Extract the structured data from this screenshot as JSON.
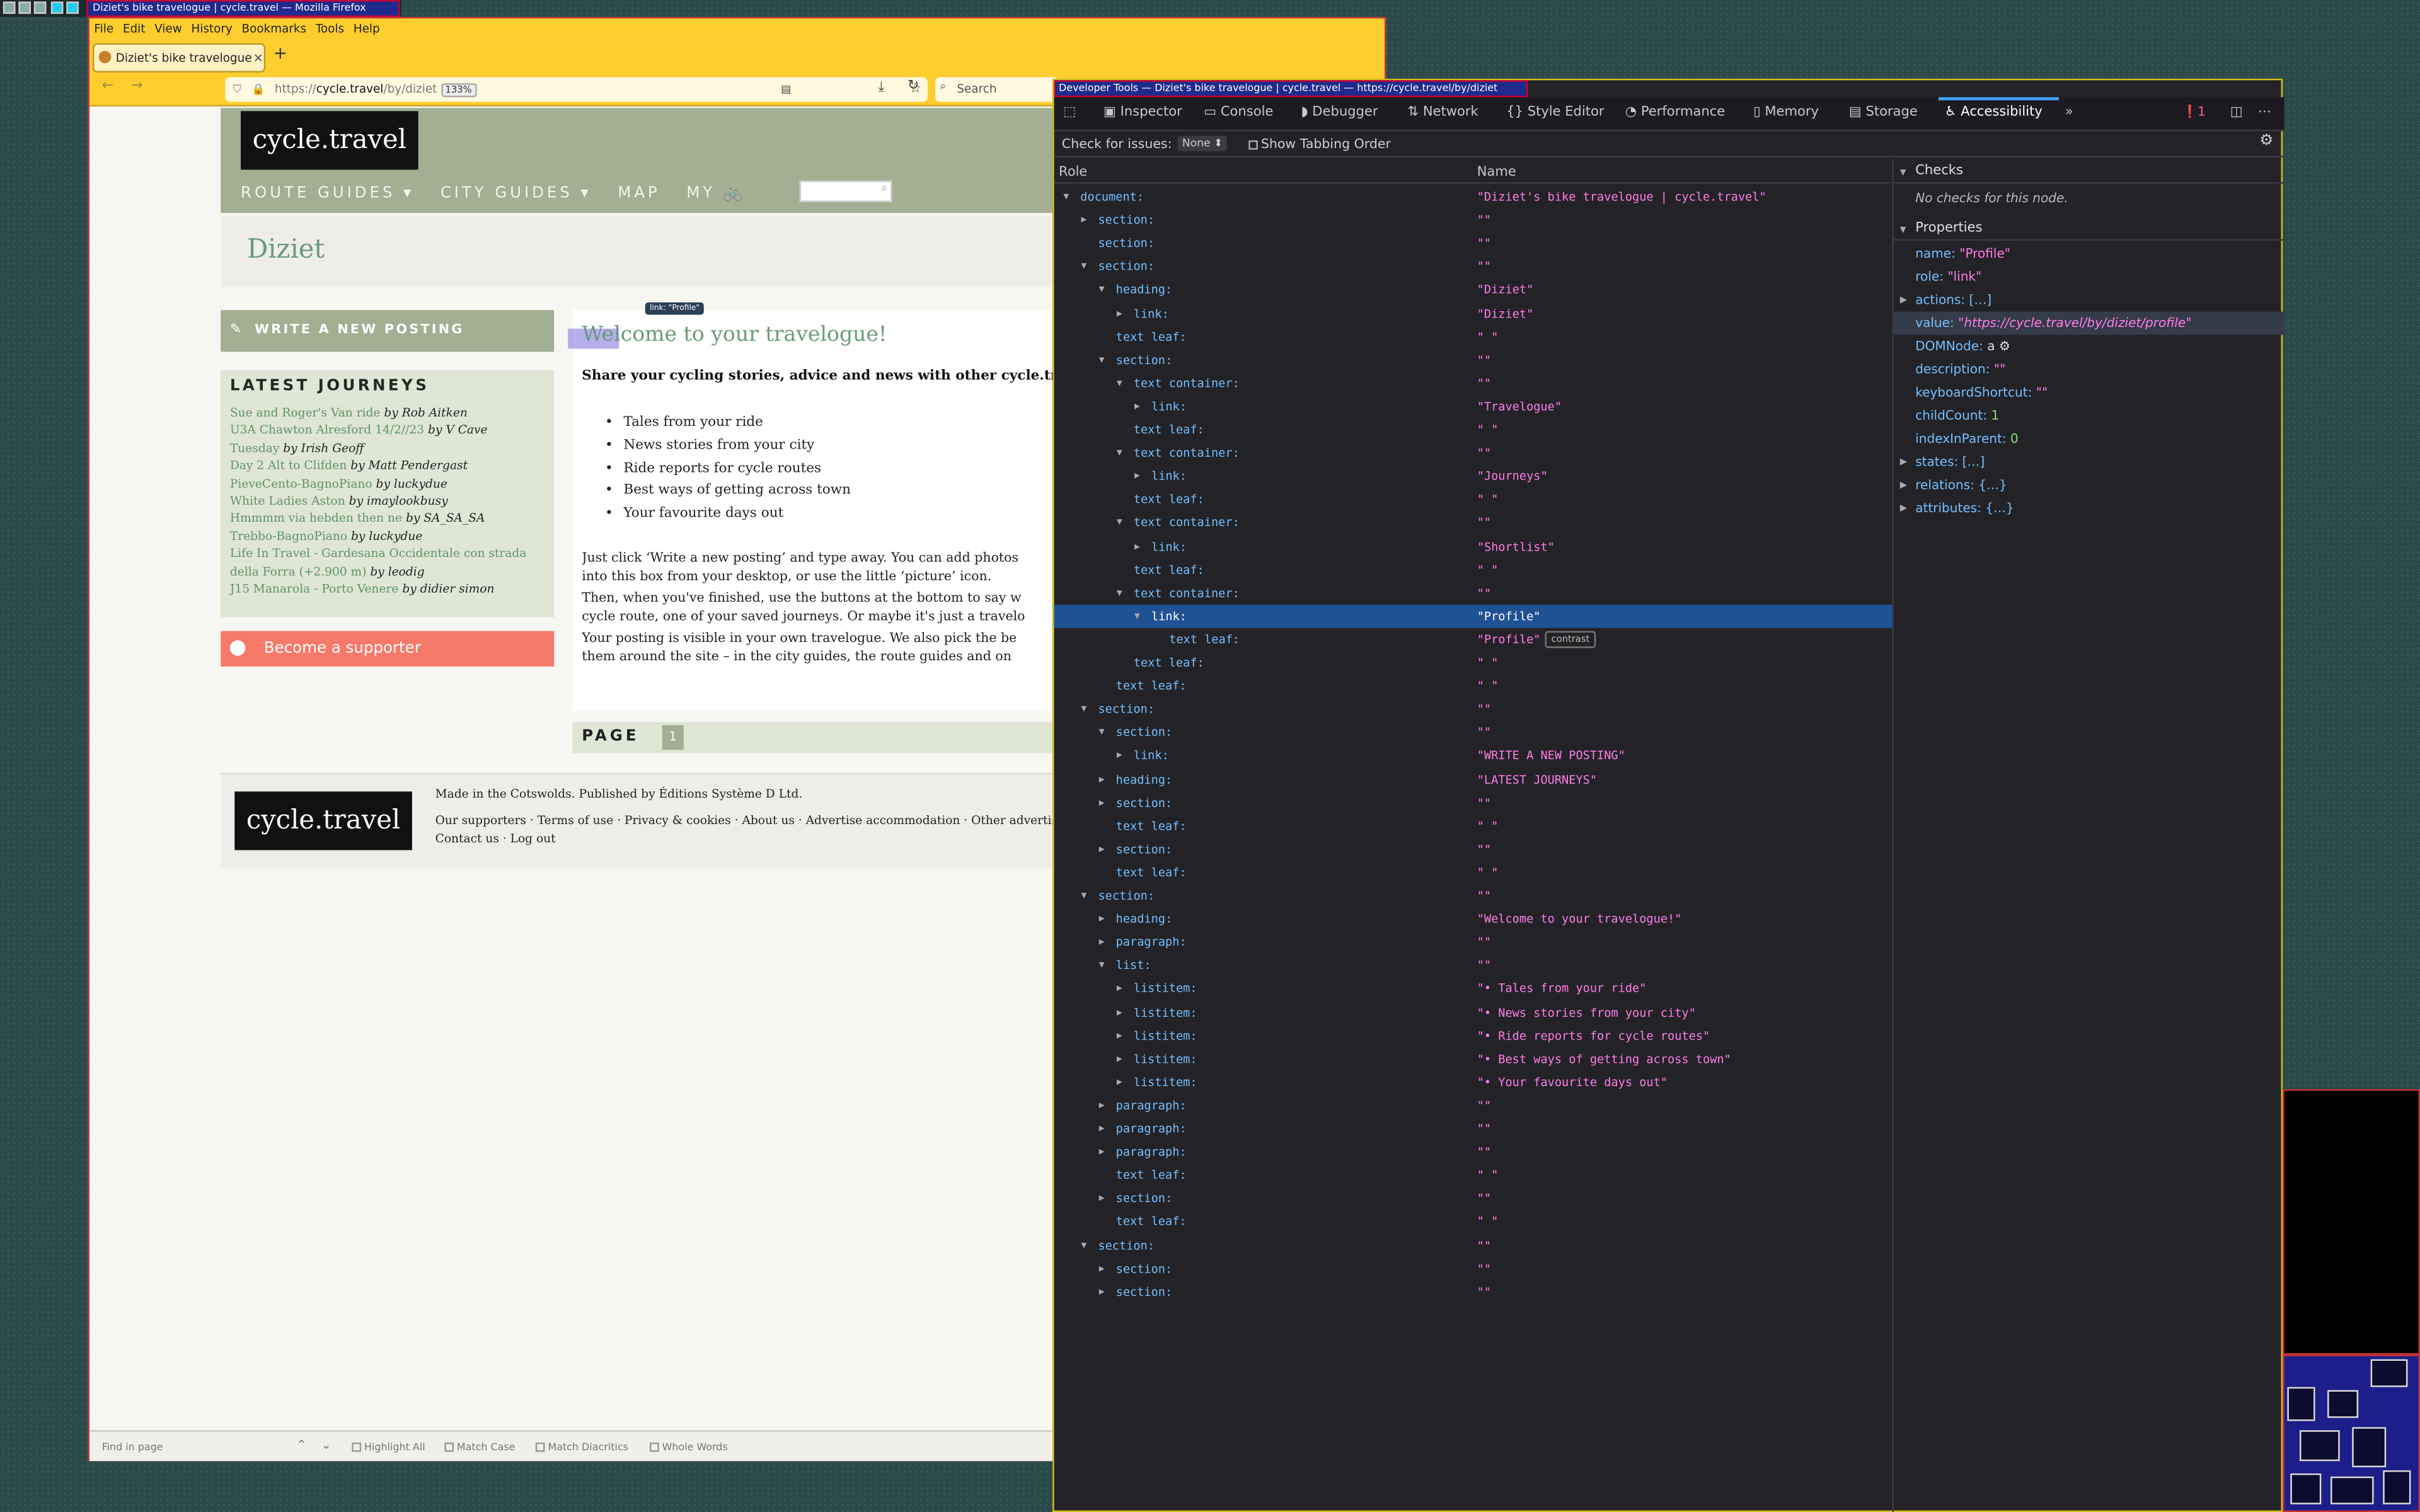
{
  "firefox": {
    "window_title": "Diziet's bike travelogue | cycle.travel — Mozilla Firefox",
    "menu": [
      "File",
      "Edit",
      "View",
      "History",
      "Bookmarks",
      "Tools",
      "Help"
    ],
    "tab_title": "Diziet's bike travelogue",
    "tab_close": "×",
    "new_tab": "+",
    "url_prefix": "https://",
    "url_domain": "cycle.travel",
    "url_path": "/by/diziet",
    "zoom": "133%",
    "search_placeholder": "Search",
    "find": {
      "placeholder": "Find in page",
      "highlight_all": "Highlight All",
      "match_case": "Match Case",
      "match_diacritics": "Match Diacritics",
      "whole_words": "Whole Words"
    }
  },
  "site": {
    "logo": "cycle.travel",
    "nav": [
      "ROUTE GUIDES ▾",
      "CITY GUIDES ▾",
      "MAP",
      "MY 🚲"
    ],
    "page_title": "Diziet",
    "write_button": "WRITE A NEW POSTING",
    "journeys_title": "LATEST JOURNEYS",
    "journeys": [
      {
        "title": "Sue and Roger's Van ride",
        "by": "by Rob Aitken"
      },
      {
        "title": "U3A Chawton Alresford 14/2//23",
        "by": "by V Cave"
      },
      {
        "title": "Tuesday",
        "by": "by Irish Geoff"
      },
      {
        "title": "Day 2 Alt to Clifden",
        "by": "by Matt Pendergast"
      },
      {
        "title": "PieveCento-BagnoPiano",
        "by": "by luckydue"
      },
      {
        "title": "White Ladies Aston",
        "by": "by imaylookbusy"
      },
      {
        "title": "Hmmmm via hebden then ne",
        "by": "by SA_SA_SA"
      },
      {
        "title": "Trebbo-BagnoPiano",
        "by": "by luckydue"
      },
      {
        "title": "Life In Travel - Gardesana Occidentale con strada",
        "by": ""
      },
      {
        "title": "della Forra (+2.900 m)",
        "by": "by leodig"
      },
      {
        "title": "J15 Manarola - Porto Venere",
        "by": "by didier simon"
      }
    ],
    "supporter": "Become a supporter",
    "welcome": "Welcome to your travelogue!",
    "tooltip": "link: \"Profile\"",
    "intro": "Share your cycling stories, advice and news with other cycle.tr",
    "bullets": [
      "Tales from your ride",
      "News stories from your city",
      "Ride reports for cycle routes",
      "Best ways of getting across town",
      "Your favourite days out"
    ],
    "para1a": "Just click ‘Write a new posting’ and type away. You can add photos",
    "para1b": "into this box from your desktop, or use the little ‘picture’ icon.",
    "para2a": "Then, when you've finished, use the buttons at the bottom to say w",
    "para2b": "cycle route, one of your saved journeys. Or maybe it's just a travelo",
    "para3a": "Your posting is visible in your own travelogue. We also pick the be",
    "para3b": "them around the site – in the city guides, the route guides and on",
    "pager_label": "PAGE",
    "pager_num": "1",
    "footer_logo": "cycle.travel",
    "footer_made": "Made in the Cotswolds. Published by Éditions Système D Ltd.",
    "footer_links1": "Our supporters · Terms of use · Privacy & cookies · About us · Advertise accommodation · Other advertising",
    "footer_links2": "Contact us · Log out"
  },
  "devtools": {
    "title": "Developer Tools — Diziet's bike travelogue | cycle.travel — https://cycle.travel/by/diziet",
    "tabs": [
      "Inspector",
      "Console",
      "Debugger",
      "Network",
      "Style Editor",
      "Performance",
      "Memory",
      "Storage",
      "Accessibility"
    ],
    "active_tab": "Accessibility",
    "error_count": "1",
    "check_label": "Check for issues:",
    "check_value": "None ⬍",
    "tabbing_label": "Show Tabbing Order",
    "col_role": "Role",
    "col_name": "Name",
    "tree": [
      {
        "d": 0,
        "t": "open",
        "role": "document:",
        "name": "\"Diziet's bike travelogue | cycle.travel\""
      },
      {
        "d": 1,
        "t": "closed",
        "role": "section:",
        "name": "\"\""
      },
      {
        "d": 1,
        "t": "none",
        "role": "section:",
        "name": "\"\""
      },
      {
        "d": 1,
        "t": "open",
        "role": "section:",
        "name": "\"\""
      },
      {
        "d": 2,
        "t": "open",
        "role": "heading:",
        "name": "\"Diziet\""
      },
      {
        "d": 3,
        "t": "closed",
        "role": "link:",
        "name": "\"Diziet\""
      },
      {
        "d": 2,
        "t": "none",
        "role": "text leaf:",
        "name": "\" \""
      },
      {
        "d": 2,
        "t": "open",
        "role": "section:",
        "name": "\"\""
      },
      {
        "d": 3,
        "t": "open",
        "role": "text container:",
        "name": "\"\""
      },
      {
        "d": 4,
        "t": "closed",
        "role": "link:",
        "name": "\"Travelogue\""
      },
      {
        "d": 3,
        "t": "none",
        "role": "text leaf:",
        "name": "\" \""
      },
      {
        "d": 3,
        "t": "open",
        "role": "text container:",
        "name": "\"\""
      },
      {
        "d": 4,
        "t": "closed",
        "role": "link:",
        "name": "\"Journeys\""
      },
      {
        "d": 3,
        "t": "none",
        "role": "text leaf:",
        "name": "\" \""
      },
      {
        "d": 3,
        "t": "open",
        "role": "text container:",
        "name": "\"\""
      },
      {
        "d": 4,
        "t": "closed",
        "role": "link:",
        "name": "\"Shortlist\""
      },
      {
        "d": 3,
        "t": "none",
        "role": "text leaf:",
        "name": "\" \""
      },
      {
        "d": 3,
        "t": "open",
        "role": "text container:",
        "name": "\"\""
      },
      {
        "d": 4,
        "t": "open",
        "role": "link:",
        "name": "\"Profile\"",
        "sel": true
      },
      {
        "d": 5,
        "t": "none",
        "role": "text leaf:",
        "name": "\"Profile\"",
        "badge": "contrast"
      },
      {
        "d": 3,
        "t": "none",
        "role": "text leaf:",
        "name": "\" \""
      },
      {
        "d": 2,
        "t": "none",
        "role": "text leaf:",
        "name": "\" \""
      },
      {
        "d": 1,
        "t": "open",
        "role": "section:",
        "name": "\"\""
      },
      {
        "d": 2,
        "t": "open",
        "role": "section:",
        "name": "\"\""
      },
      {
        "d": 3,
        "t": "closed",
        "role": "link:",
        "name": "\"WRITE A NEW POSTING\""
      },
      {
        "d": 2,
        "t": "closed",
        "role": "heading:",
        "name": "\"LATEST JOURNEYS\""
      },
      {
        "d": 2,
        "t": "closed",
        "role": "section:",
        "name": "\"\""
      },
      {
        "d": 2,
        "t": "none",
        "role": "text leaf:",
        "name": "\" \""
      },
      {
        "d": 2,
        "t": "closed",
        "role": "section:",
        "name": "\"\""
      },
      {
        "d": 2,
        "t": "none",
        "role": "text leaf:",
        "name": "\" \""
      },
      {
        "d": 1,
        "t": "open",
        "role": "section:",
        "name": "\"\""
      },
      {
        "d": 2,
        "t": "closed",
        "role": "heading:",
        "name": "\"Welcome to your travelogue!\""
      },
      {
        "d": 2,
        "t": "closed",
        "role": "paragraph:",
        "name": "\"\""
      },
      {
        "d": 2,
        "t": "open",
        "role": "list:",
        "name": "\"\""
      },
      {
        "d": 3,
        "t": "closed",
        "role": "listitem:",
        "name": "\"• Tales from your ride\""
      },
      {
        "d": 3,
        "t": "closed",
        "role": "listitem:",
        "name": "\"• News stories from your city\""
      },
      {
        "d": 3,
        "t": "closed",
        "role": "listitem:",
        "name": "\"• Ride reports for cycle routes\""
      },
      {
        "d": 3,
        "t": "closed",
        "role": "listitem:",
        "name": "\"• Best ways of getting across town\""
      },
      {
        "d": 3,
        "t": "closed",
        "role": "listitem:",
        "name": "\"• Your favourite days out\""
      },
      {
        "d": 2,
        "t": "closed",
        "role": "paragraph:",
        "name": "\"\""
      },
      {
        "d": 2,
        "t": "closed",
        "role": "paragraph:",
        "name": "\"\""
      },
      {
        "d": 2,
        "t": "closed",
        "role": "paragraph:",
        "name": "\"\""
      },
      {
        "d": 2,
        "t": "none",
        "role": "text leaf:",
        "name": "\" \""
      },
      {
        "d": 2,
        "t": "closed",
        "role": "section:",
        "name": "\"\""
      },
      {
        "d": 2,
        "t": "none",
        "role": "text leaf:",
        "name": "\" \""
      },
      {
        "d": 1,
        "t": "open",
        "role": "section:",
        "name": "\"\""
      },
      {
        "d": 2,
        "t": "closed",
        "role": "section:",
        "name": "\"\""
      },
      {
        "d": 2,
        "t": "closed",
        "role": "section:",
        "name": "\"\""
      }
    ],
    "checks_title": "Checks",
    "checks_empty": "No checks for this node.",
    "props_title": "Properties",
    "props": {
      "name_k": "name: ",
      "name_v": "\"Profile\"",
      "role_k": "role: ",
      "role_v": "\"link\"",
      "actions": "actions: […]",
      "value_k": "value: ",
      "value_v": "\"https://cycle.travel/by/diziet/profile\"",
      "dom_k": "DOMNode: ",
      "dom_v": "a",
      "desc_k": "description: ",
      "desc_v": "\"\"",
      "kbd_k": "keyboardShortcut: ",
      "kbd_v": "\"\"",
      "child_k": "childCount: ",
      "child_v": "1",
      "idx_k": "indexInParent: ",
      "idx_v": "0",
      "states": "states: […]",
      "relations": "relations: {…}",
      "attributes": "attributes: {…}"
    }
  },
  "colors": {
    "firefox_chrome": "#fece2f",
    "site_sage": "#a3ae92",
    "site_link": "#5d9468",
    "supporter": "#f6796a",
    "devtools_bg": "#232327",
    "selected_row": "#1f5294"
  }
}
